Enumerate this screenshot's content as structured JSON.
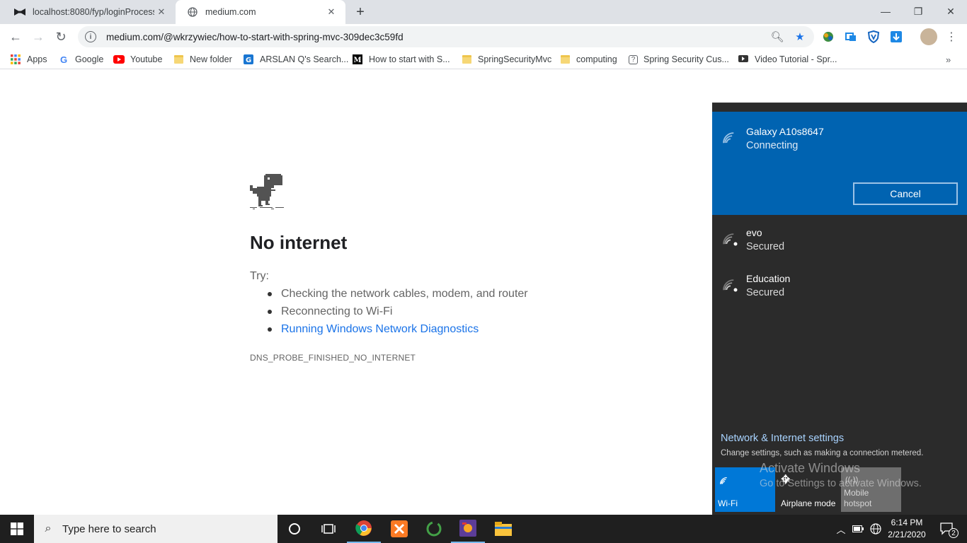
{
  "browser": {
    "tabs": [
      {
        "title": "localhost:8080/fyp/loginProcess",
        "favicon": "bowtie-icon"
      },
      {
        "title": "medium.com",
        "favicon": "globe-icon"
      }
    ],
    "url": "medium.com/@wkrzywiec/how-to-start-with-spring-mvc-309dec3c59fd",
    "bookmarks": [
      {
        "label": "Apps",
        "icon": "apps-grid-icon"
      },
      {
        "label": "Google",
        "icon": "google-icon"
      },
      {
        "label": "Youtube",
        "icon": "youtube-icon"
      },
      {
        "label": "New folder",
        "icon": "folder-icon"
      },
      {
        "label": "ARSLAN Q's Search...",
        "icon": "g-icon"
      },
      {
        "label": "How to start with S...",
        "icon": "medium-icon"
      },
      {
        "label": "SpringSecurityMvc",
        "icon": "folder-icon"
      },
      {
        "label": "computing",
        "icon": "folder-icon"
      },
      {
        "label": "Spring Security Cus...",
        "icon": "question-icon"
      },
      {
        "label": "Video Tutorial - Spr...",
        "icon": "video-icon"
      }
    ]
  },
  "error_page": {
    "title": "No internet",
    "try_label": "Try:",
    "suggestions": [
      "Checking the network cables, modem, and router",
      "Reconnecting to Wi-Fi",
      "Running Windows Network Diagnostics"
    ],
    "error_code": "DNS_PROBE_FINISHED_NO_INTERNET"
  },
  "network_flyout": {
    "connecting": {
      "name": "Galaxy A10s8647",
      "status": "Connecting",
      "button": "Cancel"
    },
    "networks": [
      {
        "name": "evo",
        "status": "Secured"
      },
      {
        "name": "Education",
        "status": "Secured"
      }
    ],
    "settings_link": "Network & Internet settings",
    "settings_desc": "Change settings, such as making a connection metered.",
    "quick_actions": [
      {
        "label": "Wi-Fi",
        "state": "on"
      },
      {
        "label": "Airplane mode",
        "state": "off"
      },
      {
        "label": "Mobile hotspot",
        "state": "disabled"
      }
    ],
    "watermark_title": "Activate Windows",
    "watermark_sub": "Go to Settings to activate Windows."
  },
  "taskbar": {
    "search_placeholder": "Type here to search",
    "time": "6:14 PM",
    "date": "2/21/2020",
    "notifications": "2"
  },
  "colors": {
    "flyout_bg": "#2b2b2b",
    "accent_blue": "#0063b1",
    "wifi_tile": "#0078d7",
    "link": "#1a73e8"
  }
}
